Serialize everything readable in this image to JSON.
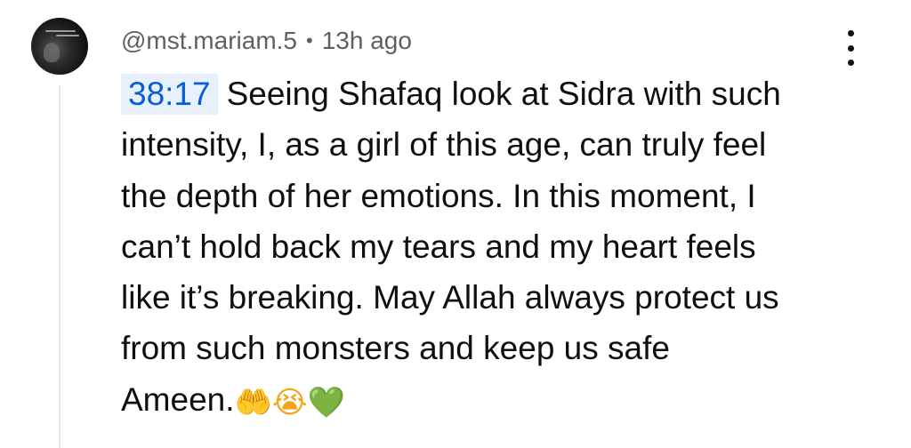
{
  "comment": {
    "handle": "@mst.mariam.5",
    "separator": "•",
    "time": "13h ago",
    "timestamp_link": "38:17",
    "lines": [
      "Seeing Shafaq look at Sidra with such",
      "intensity, I, as a girl of this age, can truly feel",
      "the depth of her emotions. In this moment, I",
      "can’t hold back my tears and my heart feels",
      "like it’s breaking. May Allah always protect us",
      "from such monsters and keep us safe",
      "Ameen."
    ],
    "emojis": [
      {
        "name": "raised-hands-emoji",
        "glyph": "🤲"
      },
      {
        "name": "crying-face-emoji",
        "glyph": "😭"
      },
      {
        "name": "green-heart-emoji",
        "glyph": "💚"
      }
    ]
  },
  "colors": {
    "timestamp_link": "#065fd4",
    "timestamp_bg": "#e8f1fb",
    "meta_text": "#606060",
    "body_text": "#0f0f0f"
  },
  "icons": {
    "menu": "more-vertical-icon",
    "avatar": "user-avatar"
  }
}
